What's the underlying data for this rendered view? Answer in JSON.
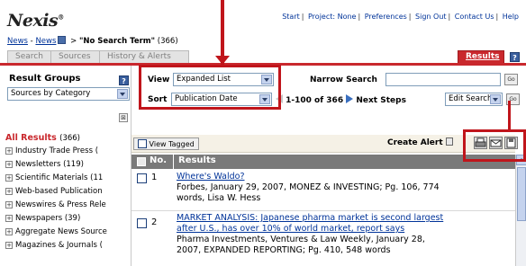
{
  "header": {
    "logo": "Nexis",
    "logo_mark": "®",
    "links": [
      "Start",
      "Project: None",
      "Preferences",
      "Sign Out",
      "Contact Us",
      "Help"
    ],
    "link_separator": "|"
  },
  "breadcrumb": {
    "news_1": "News",
    "sep1": " - ",
    "news_2": "News",
    "sep2": " > ",
    "query": "\"No Search Term\"",
    "count": " (366)"
  },
  "tabs": {
    "search": "Search",
    "sources": "Sources",
    "history": "History & Alerts",
    "results": "Results",
    "help_icon": "?"
  },
  "sidebar": {
    "title": "Result Groups",
    "help_icon": "?",
    "group_select": "Sources by Category",
    "collapse": "⊠",
    "all_results": "All Results",
    "all_count": "(366)",
    "groups": [
      {
        "label": "Industry Trade Press ("
      },
      {
        "label": "Newsletters (119)"
      },
      {
        "label": "Scientific Materials (11"
      },
      {
        "label": "Web-based Publication"
      },
      {
        "label": "Newswires & Press Rele"
      },
      {
        "label": "Newspapers (39)"
      },
      {
        "label": "Aggregate News Source"
      },
      {
        "label": "Magazines & Journals ("
      }
    ],
    "expand_glyph": "+"
  },
  "controls": {
    "view_label": "View",
    "view_value": "Expanded List",
    "narrow_label": "Narrow Search",
    "narrow_value": "",
    "go": "Go",
    "sort_label": "Sort",
    "sort_value": "Publication Date",
    "range_text": "1-100 of 366",
    "next_steps_label": "Next Steps",
    "next_steps_value": "Edit Search",
    "view_tagged": "View Tagged",
    "create_alert": "Create Alert"
  },
  "table": {
    "col_no": "No.",
    "col_results": "Results",
    "rows": [
      {
        "num": "1",
        "title": "Where's Waldo?",
        "meta_1": "Forbes, January 29, 2007, MONEZ & INVESTING; Pg. 106, 774",
        "meta_2": "words, Lisa W. Hess"
      },
      {
        "num": "2",
        "title_1": "MARKET ANALYSIS: Japanese pharma market is second largest",
        "title_2": "after U.S., has over 10% of world market, report says",
        "meta_1": "Pharma Investments, Ventures & Law Weekly, January 28,",
        "meta_2": "2007, EXPANDED REPORTING; Pg. 410, 548 words"
      }
    ]
  },
  "icons": {
    "print": "printer-icon",
    "email": "email-icon",
    "download": "download-icon",
    "alert": "alert-icon"
  },
  "colors": {
    "nexis_red": "#c9282d",
    "link_blue": "#003399",
    "table_header": "#7a7a7a",
    "annotation_red": "#c0151b"
  }
}
